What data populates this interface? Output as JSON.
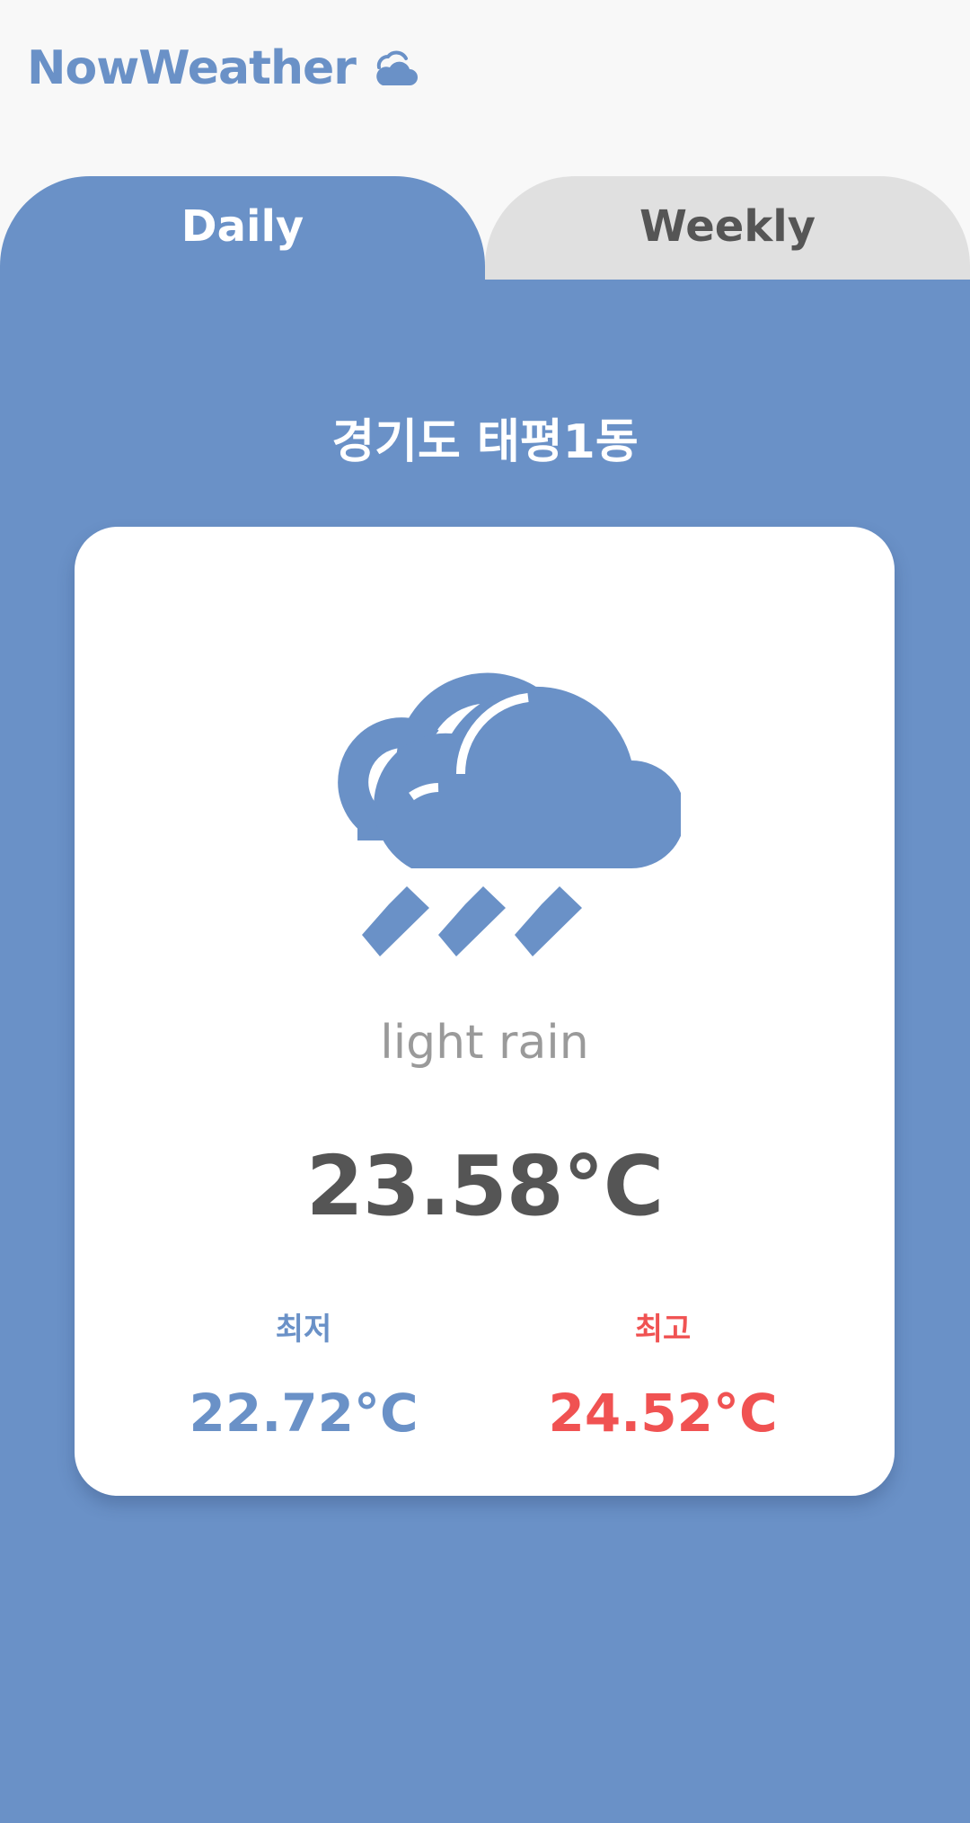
{
  "app": {
    "title": "NowWeather"
  },
  "tabs": [
    {
      "label": "Daily",
      "active": true
    },
    {
      "label": "Weekly",
      "active": false
    }
  ],
  "location": "경기도 태평1동",
  "weather": {
    "icon": "cloud-rain-icon",
    "condition": "light rain",
    "temp": "23.58°C",
    "min_label": "최저",
    "min_value": "22.72°C",
    "max_label": "최고",
    "max_value": "24.52°C"
  },
  "colors": {
    "accent": "#6a91c7",
    "background": "#f8f8f8",
    "tab_inactive": "#e0e0e0",
    "text_dark": "#555555",
    "text_muted": "#9a9a9a",
    "high_temp": "#f05252"
  }
}
